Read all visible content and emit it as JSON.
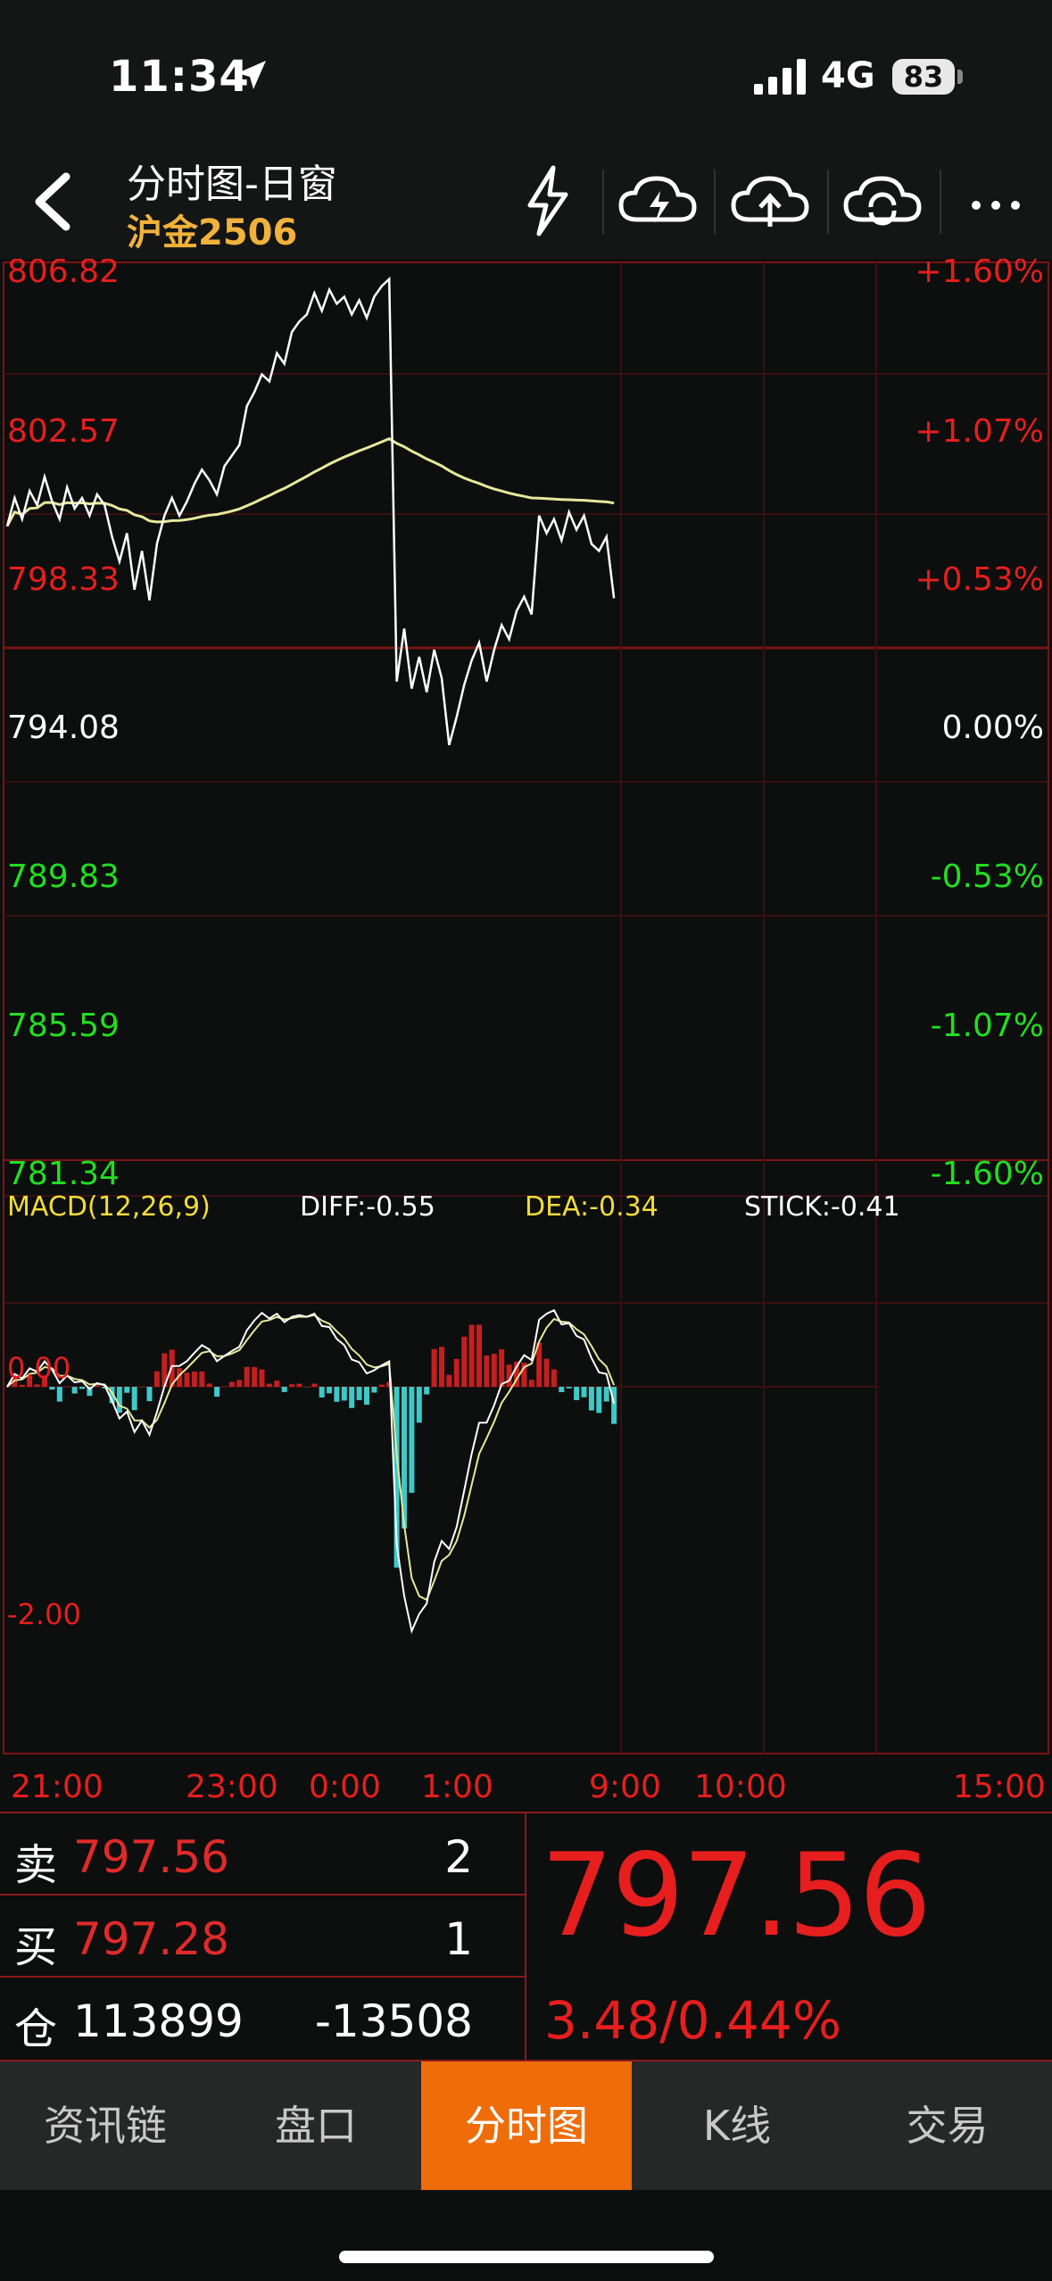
{
  "status_bar": {
    "time": "11:34",
    "network": "4G",
    "battery": "83"
  },
  "nav": {
    "title": "分时图-日窗",
    "subtitle": "沪金2506",
    "icons": [
      "back-icon",
      "lightning-icon",
      "cloud-lightning-icon",
      "cloud-upload-icon",
      "cloud-refresh-icon",
      "more-icon"
    ]
  },
  "chart_data": {
    "type": "line",
    "instrument": "沪金2506",
    "y_labels_left": [
      "806.82",
      "802.57",
      "798.33",
      "794.08",
      "789.83",
      "785.59",
      "781.34"
    ],
    "y_labels_right": [
      "+1.60%",
      "+1.07%",
      "+0.53%",
      "0.00%",
      "-0.53%",
      "-1.07%",
      "-1.60%"
    ],
    "ylim": [
      781.34,
      806.82
    ],
    "baseline": 794.08,
    "x_labels": [
      "21:00",
      "23:00",
      "0:00",
      "1:00",
      "9:00",
      "10:00",
      "15:00"
    ],
    "price_series": {
      "x": [
        0,
        4,
        8,
        12,
        16,
        20,
        24,
        28,
        32,
        36,
        40,
        44,
        48,
        52,
        56,
        60,
        64,
        68,
        72,
        76,
        80,
        84,
        88,
        92,
        96,
        100,
        104,
        108,
        112,
        116,
        120,
        124,
        128,
        132,
        136,
        140,
        144,
        148,
        152,
        156,
        160,
        164,
        168,
        172,
        176,
        180,
        184,
        188,
        192,
        196,
        200,
        204,
        208,
        212,
        216,
        220,
        224,
        228,
        232,
        236,
        240,
        244,
        248,
        252,
        256,
        260,
        264,
        268,
        272,
        276,
        280,
        284,
        288,
        292,
        296,
        300,
        304,
        308,
        312,
        316,
        320,
        324,
        328,
        332,
        336,
        340,
        344,
        348,
        352,
        356,
        360,
        364,
        368,
        372,
        376,
        380,
        384,
        388,
        392,
        396,
        400,
        404,
        408,
        412,
        416,
        420,
        424,
        428,
        432,
        436,
        440,
        444,
        448,
        452,
        456,
        460,
        464
      ],
      "y": [
        799.6,
        800.4,
        799.8,
        800.6,
        800.2,
        801.0,
        800.3,
        799.8,
        800.7,
        800.1,
        800.4,
        799.9,
        800.5,
        800.2,
        799.3,
        798.6,
        799.4,
        797.8,
        798.9,
        797.5,
        799.1,
        799.9,
        800.4,
        799.9,
        800.3,
        800.8,
        801.2,
        800.9,
        800.5,
        801.3,
        801.6,
        801.9,
        803.0,
        803.4,
        803.9,
        803.7,
        804.5,
        804.2,
        805.1,
        805.4,
        805.6,
        806.2,
        805.7,
        806.3,
        805.9,
        806.1,
        805.6,
        806.0,
        805.5,
        806.1,
        806.4,
        806.6,
        795.2,
        796.7,
        795.0,
        795.9,
        794.9,
        796.1,
        795.3,
        793.4,
        794.2,
        795.1,
        795.8,
        796.3,
        795.2,
        796.1,
        796.8,
        796.4,
        797.2,
        797.6,
        797.1,
        799.9,
        799.4,
        799.8,
        799.2,
        800.0,
        799.5,
        799.9,
        799.1,
        798.9,
        799.3,
        797.56
      ],
      "color": "#ffffff"
    },
    "avg_series": {
      "color": "#e8e89a"
    },
    "macd": {
      "label": "MACD(12,26,9)",
      "diff": "DIFF:-0.55",
      "dea": "DEA:-0.34",
      "stick": "STICK:-0.41",
      "level_labels": [
        "0.00",
        "-2.00"
      ],
      "diff_color": "#ffffff",
      "dea_color": "#e8e89a",
      "pos_color": "#c41f1f",
      "neg_color": "#3ec9c9"
    },
    "grid": true
  },
  "quote": {
    "sell_label": "卖",
    "sell_price": "797.56",
    "sell_vol": "2",
    "buy_label": "买",
    "buy_price": "797.28",
    "buy_vol": "1",
    "oi_label": "仓",
    "oi_value": "113899",
    "oi_change": "-13508",
    "last_price": "797.56",
    "change": "3.48/0.44%"
  },
  "tabs": [
    "资讯链",
    "盘口",
    "分时图",
    "K线",
    "交易"
  ],
  "active_tab": "分时图",
  "colors": {
    "up": "#e61e1e",
    "down": "#22dd22",
    "accent": "#ef6c0a",
    "gold": "#f0b23a"
  }
}
